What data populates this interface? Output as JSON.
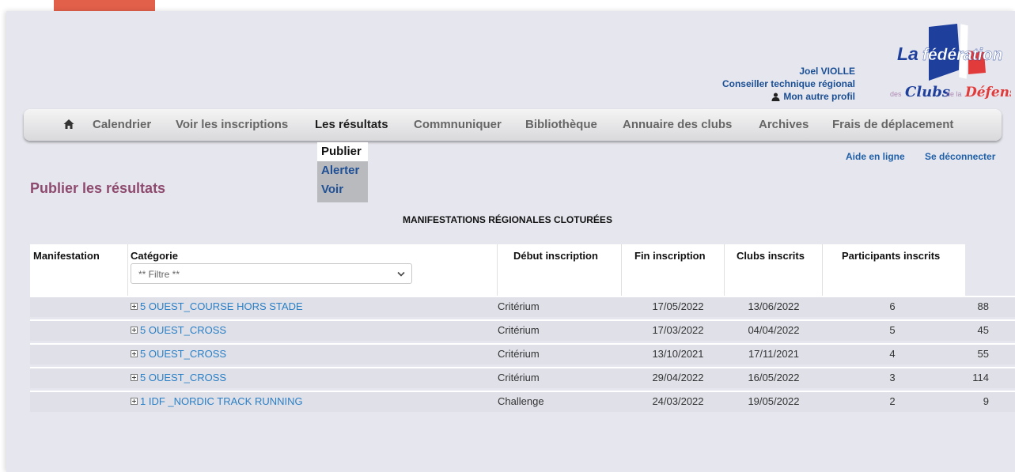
{
  "user": {
    "name": "Joel VIOLLE",
    "role": "Conseiller technique régional",
    "profile_link": "Mon autre profil"
  },
  "logo": {
    "text_la": "La",
    "text_federation": "fédération",
    "text_des": "des",
    "text_clubs": "Clubs",
    "text_de_la": "de la",
    "text_defense": "Défense"
  },
  "nav": {
    "home_icon": "home-icon",
    "items": [
      {
        "label": "Calendrier"
      },
      {
        "label": "Voir les inscriptions"
      },
      {
        "label": "Les résultats",
        "active": true
      },
      {
        "label": "Commnuniquer"
      },
      {
        "label": "Bibliothèque"
      },
      {
        "label": "Annuaire des clubs"
      },
      {
        "label": "Archives"
      },
      {
        "label": "Frais de déplacement"
      }
    ],
    "submenu": [
      {
        "label": "Publier",
        "selected": true
      },
      {
        "label": "Alerter"
      },
      {
        "label": "Voir"
      }
    ]
  },
  "links": {
    "help": "Aide en ligne",
    "logout": "Se déconnecter"
  },
  "page_title": "Publier les résultats",
  "table": {
    "heading": "MANIFESTATIONS RÉGIONALES CLOTURÉES",
    "columns": [
      "Manifestation",
      "Catégorie",
      "Début inscription",
      "Fin inscription",
      "Clubs inscrits",
      "Participants inscrits"
    ],
    "filter_value": "** Filtre **",
    "rows": [
      {
        "category": "5 OUEST_COURSE HORS STADE",
        "type": "Critérium",
        "start": "17/05/2022",
        "end": "13/06/2022",
        "clubs": "6",
        "participants": "88"
      },
      {
        "category": "5 OUEST_CROSS",
        "type": "Critérium",
        "start": "17/03/2022",
        "end": "04/04/2022",
        "clubs": "5",
        "participants": "45"
      },
      {
        "category": "5 OUEST_CROSS",
        "type": "Critérium",
        "start": "13/10/2021",
        "end": "17/11/2021",
        "clubs": "4",
        "participants": "55"
      },
      {
        "category": "5 OUEST_CROSS",
        "type": "Critérium",
        "start": "29/04/2022",
        "end": "16/05/2022",
        "clubs": "3",
        "participants": "114"
      },
      {
        "category": "1 IDF _NORDIC TRACK RUNNING",
        "type": "Challenge",
        "start": "24/03/2022",
        "end": "19/05/2022",
        "clubs": "2",
        "participants": "9"
      }
    ]
  },
  "colors": {
    "accent_tab": "#e2604a",
    "page_bg": "#e6e7ee",
    "link_blue": "#2b7fc5",
    "title_color": "#8e4a6e",
    "user_blue": "#1a4e94"
  }
}
